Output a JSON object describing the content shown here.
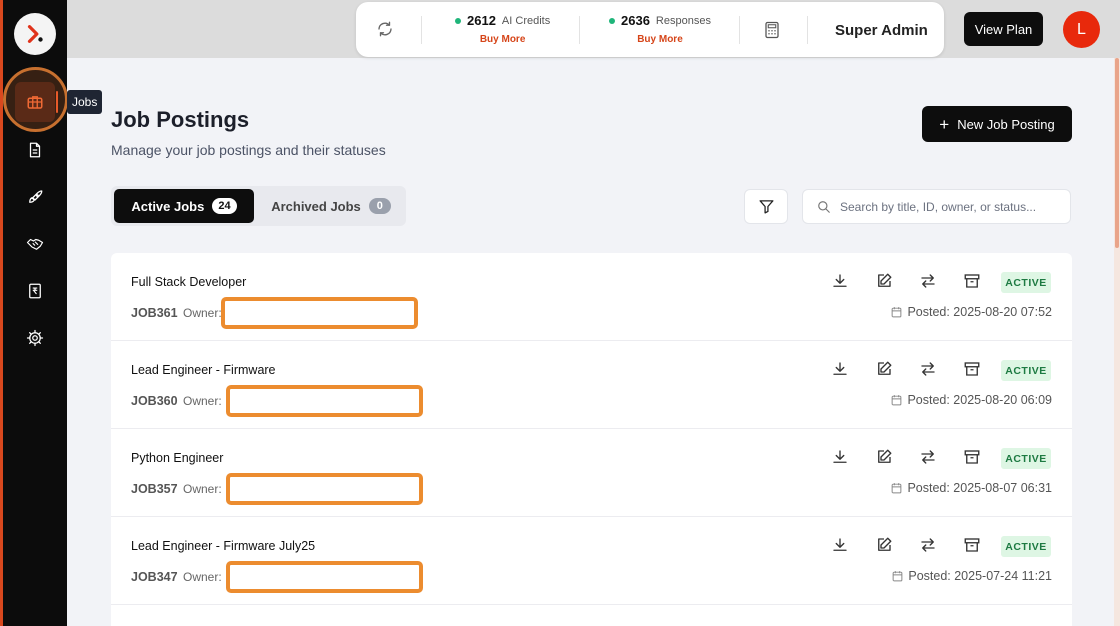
{
  "sidebar": {
    "tooltip": "Jobs",
    "items": [
      {
        "icon": "briefcase-icon",
        "active": true
      },
      {
        "icon": "document-icon"
      },
      {
        "icon": "rocket-icon"
      },
      {
        "icon": "handshake-icon"
      },
      {
        "icon": "rupee-receipt-icon"
      },
      {
        "icon": "gear-icon"
      }
    ]
  },
  "topbar": {
    "ai_credits": {
      "value": "2612",
      "label": "AI Credits",
      "buy": "Buy More"
    },
    "responses": {
      "value": "2636",
      "label": "Responses",
      "buy": "Buy More"
    },
    "role": "Super Admin",
    "view_plan": "View Plan",
    "avatar_initial": "L"
  },
  "header": {
    "title": "Job Postings",
    "subtitle": "Manage your job postings and their statuses",
    "new_button": "New Job Posting"
  },
  "tabs": {
    "active": {
      "label": "Active Jobs",
      "count": "24"
    },
    "archived": {
      "label": "Archived Jobs",
      "count": "0"
    }
  },
  "search": {
    "placeholder": "Search by title, ID, owner, or status..."
  },
  "jobs": [
    {
      "title": "Full Stack Developer",
      "id": "JOB361",
      "owner_label": "Owner:",
      "status": "ACTIVE",
      "posted": "Posted: 2025-08-20 07:52"
    },
    {
      "title": "Lead Engineer - Firmware",
      "id": "JOB360",
      "owner_label": "Owner:",
      "status": "ACTIVE",
      "posted": "Posted: 2025-08-20 06:09"
    },
    {
      "title": "Python Engineer",
      "id": "JOB357",
      "owner_label": "Owner:",
      "status": "ACTIVE",
      "posted": "Posted: 2025-08-07 06:31"
    },
    {
      "title": "Lead Engineer - Firmware July25",
      "id": "JOB347",
      "owner_label": "Owner:",
      "status": "ACTIVE",
      "posted": "Posted: 2025-07-24 11:21"
    }
  ],
  "colors": {
    "accent": "#d64519",
    "status_bg": "#def6e4",
    "status_text": "#1d7a42",
    "redaction": "#ec8c2f"
  }
}
